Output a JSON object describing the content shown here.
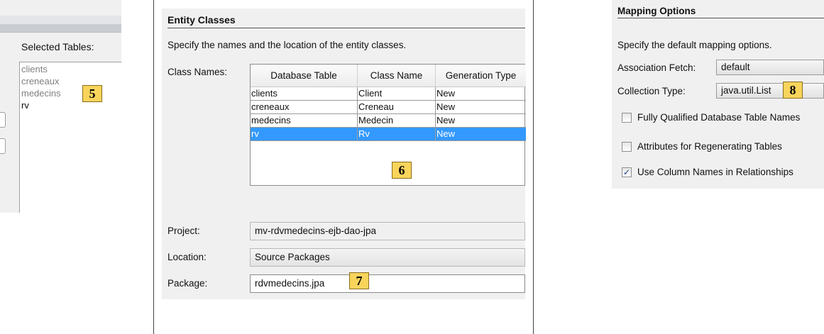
{
  "left_panel": {
    "label": "Selected Tables:",
    "items": [
      {
        "text": "clients",
        "dim": true
      },
      {
        "text": "creneaux",
        "dim": true
      },
      {
        "text": "medecins",
        "dim": true
      },
      {
        "text": "rv",
        "dim": false
      }
    ]
  },
  "badges": {
    "b5": "5",
    "b6": "6",
    "b7": "7",
    "b8": "8"
  },
  "entity_classes": {
    "title": "Entity Classes",
    "description": "Specify the names and the location of the entity classes.",
    "class_names_label": "Class Names:",
    "columns": [
      "Database Table",
      "Class Name",
      "Generation Type"
    ],
    "rows": [
      {
        "table": "clients",
        "class": "Client",
        "gen": "New",
        "selected": false
      },
      {
        "table": "creneaux",
        "class": "Creneau",
        "gen": "New",
        "selected": false
      },
      {
        "table": "medecins",
        "class": "Medecin",
        "gen": "New",
        "selected": false
      },
      {
        "table": "rv",
        "class": "Rv",
        "gen": "New",
        "selected": true
      }
    ],
    "project_label": "Project:",
    "project_value": "mv-rdvmedecins-ejb-dao-jpa",
    "location_label": "Location:",
    "location_value": "Source Packages",
    "package_label": "Package:",
    "package_value": "rdvmedecins.jpa"
  },
  "mapping_options": {
    "title": "Mapping Options",
    "description": "Specify the default mapping options.",
    "assoc_label": "Association Fetch:",
    "assoc_value": "default",
    "collection_label": "Collection Type:",
    "collection_value": "java.util.List",
    "checkboxes": [
      {
        "label": "Fully Qualified Database Table Names",
        "checked": false
      },
      {
        "label": "Attributes for Regenerating Tables",
        "checked": false
      },
      {
        "label": "Use Column Names in Relationships",
        "checked": true
      }
    ]
  },
  "colors": {
    "selection": "#3399ff",
    "badge": "#f9d45b",
    "panel": "#f0f0f0"
  }
}
